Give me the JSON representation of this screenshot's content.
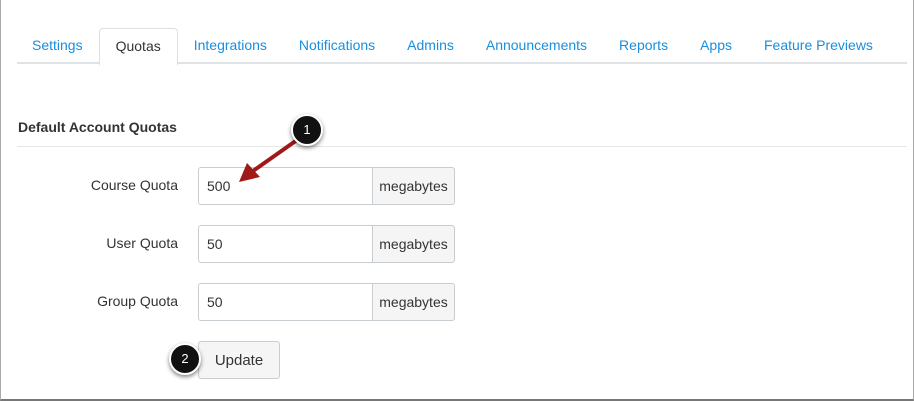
{
  "tabs": [
    "Settings",
    "Quotas",
    "Integrations",
    "Notifications",
    "Admins",
    "Announcements",
    "Reports",
    "Apps",
    "Feature Previews"
  ],
  "active_tab": "Quotas",
  "section_title": "Default Account Quotas",
  "fields": [
    {
      "label": "Course Quota",
      "value": "500",
      "unit": "megabytes"
    },
    {
      "label": "User Quota",
      "value": "50",
      "unit": "megabytes"
    },
    {
      "label": "Group Quota",
      "value": "50",
      "unit": "megabytes"
    }
  ],
  "update_label": "Update",
  "callouts": [
    "1",
    "2"
  ],
  "colors": {
    "link": "#1a8ede",
    "arrow": "#a01818"
  }
}
